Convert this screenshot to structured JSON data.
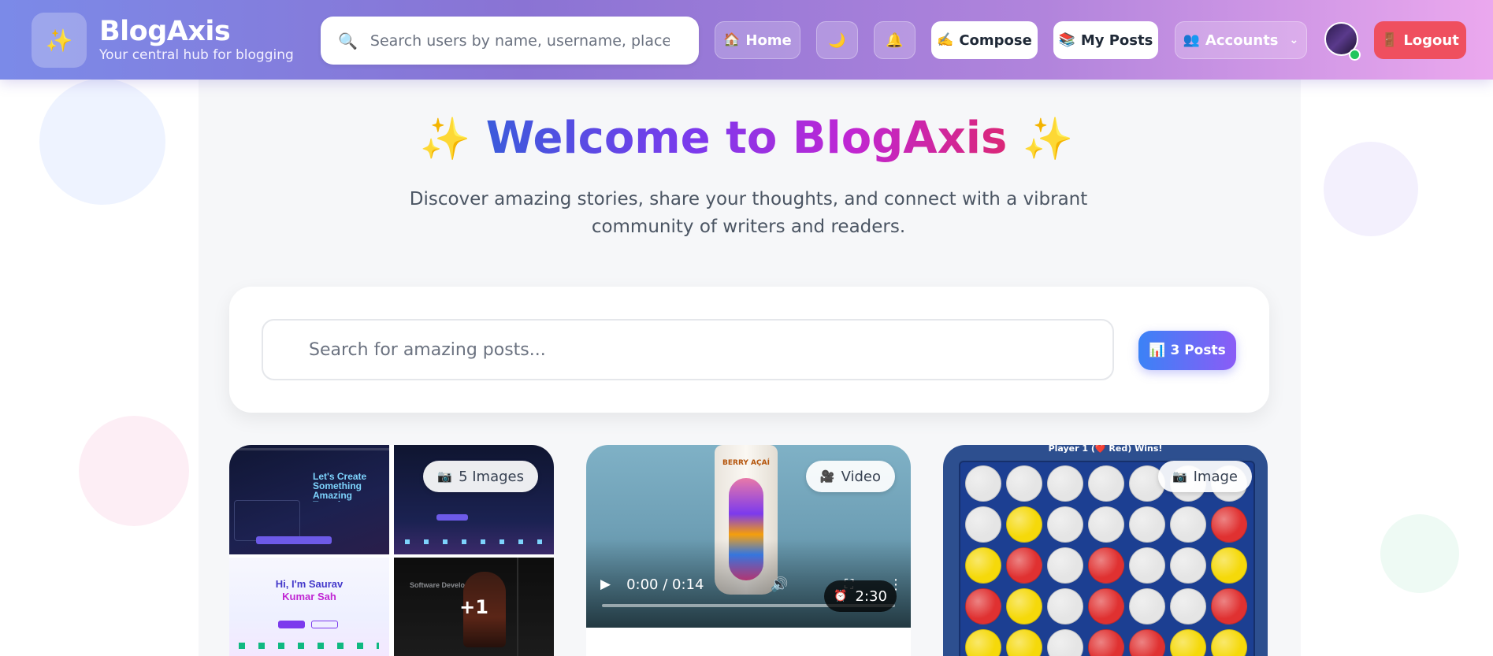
{
  "brand": {
    "logo_icon": "sparkles-icon",
    "title": "BlogAxis",
    "subtitle": "Your central hub for blogging"
  },
  "top_search": {
    "placeholder": "Search users by name, username, place..."
  },
  "nav": {
    "home": {
      "icon": "house-icon",
      "label": "Home"
    },
    "theme_icon": "moon-icon",
    "notifications_icon": "bell-icon",
    "compose": {
      "icon": "writing-hand-icon",
      "label": "Compose"
    },
    "my_posts": {
      "icon": "books-icon",
      "label": "My Posts"
    },
    "accounts": {
      "icon": "people-icon",
      "label": "Accounts"
    },
    "logout": {
      "icon": "door-icon",
      "label": "Logout"
    }
  },
  "hero": {
    "title": "Welcome to BlogAxis",
    "subtitle": "Discover amazing stories, share your thoughts, and connect with a vibrant community of writers and readers."
  },
  "post_search": {
    "placeholder": "Search for amazing posts...",
    "count_label": "3 Posts"
  },
  "posts": [
    {
      "badge": "5 Images",
      "badge_icon": "camera-icon",
      "more_label": "+1",
      "tile1": "Let's Create Something Amazing Together",
      "tile3_a": "Hi, I'm Saurav",
      "tile3_b": "Kumar Sah",
      "tile4": "Software Developer"
    },
    {
      "badge": "Video",
      "badge_icon": "video-camera-icon",
      "time": "0:00 / 0:14",
      "duration": "2:30",
      "duration_icon": "alarm-clock-icon",
      "can_label": "BERRY AÇAÍ"
    },
    {
      "badge": "Image",
      "badge_icon": "camera-icon",
      "caption": "Player 1 (❤️ Red) Wins!",
      "board": [
        [
          "w",
          "w",
          "w",
          "w",
          "w",
          "w",
          "w"
        ],
        [
          "w",
          "y",
          "w",
          "w",
          "w",
          "w",
          "r"
        ],
        [
          "y",
          "r",
          "w",
          "r",
          "w",
          "w",
          "y"
        ],
        [
          "r",
          "y",
          "w",
          "r",
          "w",
          "w",
          "r"
        ],
        [
          "y",
          "y",
          "w",
          "r",
          "r",
          "y",
          "y"
        ]
      ]
    }
  ]
}
